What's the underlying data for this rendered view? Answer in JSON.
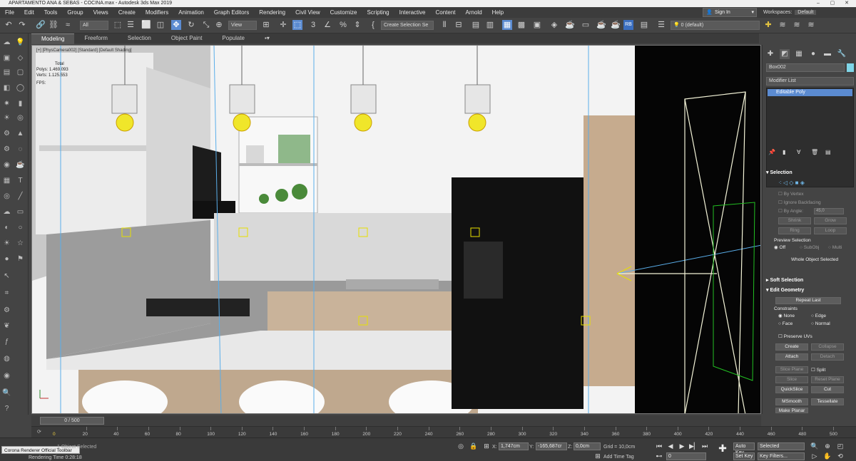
{
  "window": {
    "title": "APARTAMENTO ANA & SEBAS - COCINA.max - Autodesk 3ds Max 2019",
    "controls": [
      "–",
      "▢",
      "✕"
    ]
  },
  "menu": {
    "items": [
      "File",
      "Edit",
      "Tools",
      "Group",
      "Views",
      "Create",
      "Modifiers",
      "Animation",
      "Graph Editors",
      "Rendering",
      "Civil View",
      "Customize",
      "Scripting",
      "Interactive",
      "Content",
      "Arnold",
      "Help"
    ],
    "sign_in": "Sign In",
    "workspace_label": "Workspaces:",
    "workspace_value": "Default"
  },
  "toolbar": {
    "selection_filter": "All",
    "ref_coord": "View",
    "selection_set": "Create Selection Se",
    "layer": "0 (default)"
  },
  "ribbon": {
    "tabs": [
      "Modeling",
      "Freeform",
      "Selection",
      "Object Paint",
      "Populate"
    ]
  },
  "viewport": {
    "label": "[+] [PhysCamera002] [Standard] [Default Shading]",
    "stats_title": "Total",
    "stats_polys_label": "Polys:",
    "stats_polys": "1.469.093",
    "stats_verts_label": "Verts:",
    "stats_verts": "1.125.553",
    "stats_fps": "FPS:"
  },
  "command_panel": {
    "object_name": "Box002",
    "modifier_list": "Modifier List",
    "stack_item": "Editable Poly",
    "selection": {
      "title": "Selection",
      "by_vertex": "By Vertex",
      "ignore_backfacing": "Ignore Backfacing",
      "by_angle": "By Angle:",
      "angle_value": "45,0",
      "shrink": "Shrink",
      "grow": "Grow",
      "ring": "Ring",
      "loop": "Loop",
      "preview_selection": "Preview Selection",
      "off": "Off",
      "subobj": "SubObj",
      "multi": "Multi",
      "whole_object": "Whole Object Selected"
    },
    "soft_selection": "Soft Selection",
    "edit_geometry": {
      "title": "Edit Geometry",
      "repeat_last": "Repeat Last",
      "constraints": "Constraints",
      "none": "None",
      "edge": "Edge",
      "face": "Face",
      "normal": "Normal",
      "preserve_uvs": "Preserve UVs",
      "create": "Create",
      "collapse": "Collapse",
      "attach": "Attach",
      "detach": "Detach",
      "slice_plane": "Slice Plane",
      "split": "Split",
      "slice": "Slice",
      "reset_plane": "Reset Plane",
      "quickslice": "QuickSlice",
      "cut": "Cut",
      "msmooth": "MSmooth",
      "tessellate": "Tessellate",
      "make_planar": "Make Planar"
    }
  },
  "timeline": {
    "frame_display": "0 / 500",
    "ticks": [
      "20",
      "40",
      "60",
      "80",
      "100",
      "120",
      "140",
      "160",
      "180",
      "200",
      "220",
      "240",
      "260",
      "280",
      "300",
      "320",
      "340",
      "360",
      "380",
      "400",
      "420",
      "440",
      "460",
      "480",
      "500"
    ],
    "first_tick": "0"
  },
  "status": {
    "selected": "1 Object Selected",
    "rendering_time": "Rendering Time  0:28:18",
    "tooltip": "Corona Renderer Official Toolbar",
    "x_label": "X:",
    "x_value": "1,747cm",
    "y_label": "Y:",
    "y_value": "-165,687cr",
    "z_label": "Z:",
    "z_value": "0,0cm",
    "grid": "Grid = 10,0cm",
    "add_time_tag": "Add Time Tag",
    "frame": "0",
    "auto_key": "Auto Key",
    "selected_dropdown": "Selected",
    "set_key": "Set Key",
    "key_filters": "Key Filters..."
  },
  "colors": {
    "ui_bg": "#444444",
    "accent_blue": "#5b8bd1",
    "selection_yellow": "#e6e000",
    "object_swatch": "#7fd6e8"
  }
}
